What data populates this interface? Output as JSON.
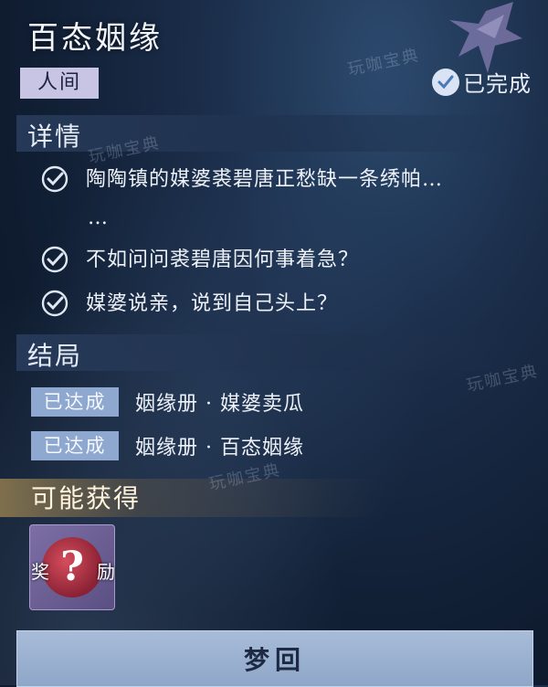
{
  "header": {
    "title": "百态姻缘",
    "tag": "人间",
    "status": "已完成"
  },
  "details": {
    "section_title": "详情",
    "items": [
      "陶陶镇的媒婆裘碧唐正愁缺一条绣帕…",
      "不如问问裘碧唐因何事着急？",
      "媒婆说亲，说到自己头上？"
    ],
    "continuation": "…"
  },
  "endings": {
    "section_title": "结局",
    "items": [
      {
        "badge": "已达成",
        "text": "姻缘册 · 媒婆卖瓜"
      },
      {
        "badge": "已达成",
        "text": "姻缘册 · 百态姻缘"
      }
    ]
  },
  "rewards": {
    "section_title": "可能获得",
    "item": {
      "left": "奖",
      "right": "励",
      "mark": "?"
    }
  },
  "footer": {
    "return_label": "梦回"
  },
  "watermarks": [
    "玩咖宝典",
    "玩咖宝典",
    "玩咖宝典",
    "玩咖宝典"
  ]
}
